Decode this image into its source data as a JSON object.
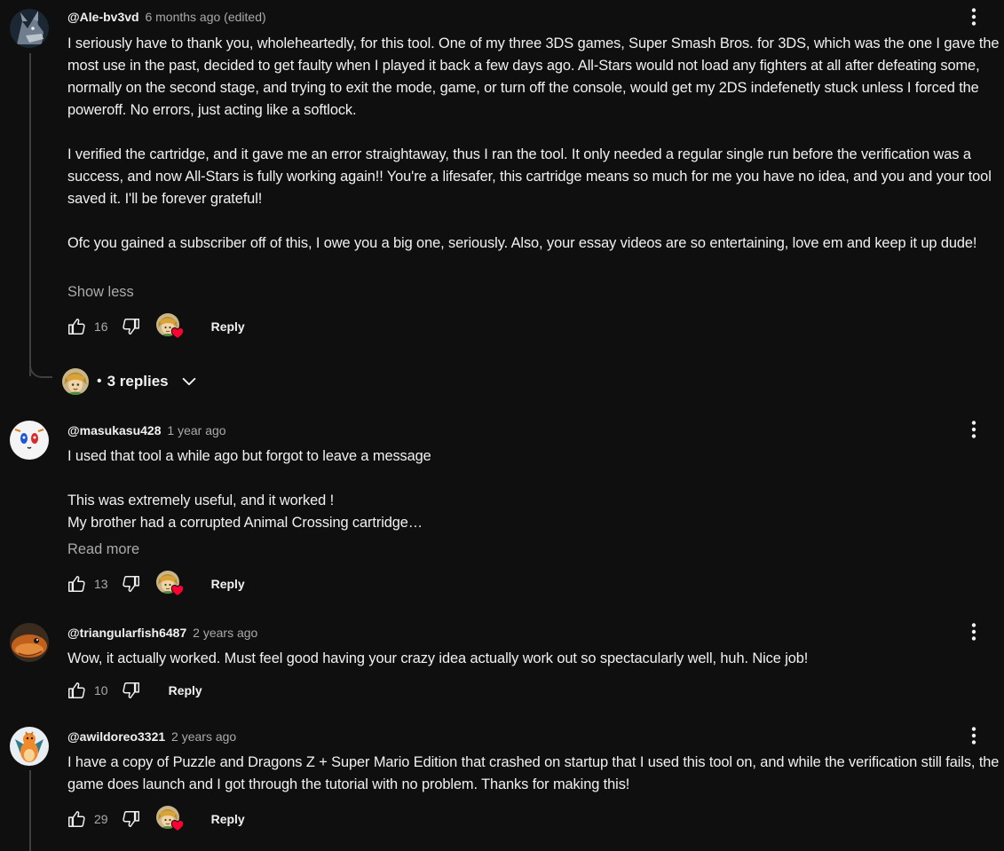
{
  "comments": [
    {
      "author": "@Ale-bv3vd",
      "time": "6 months ago (edited)",
      "text": "I seriously have to thank you, wholeheartedly, for this tool. One of my three 3DS games, Super Smash Bros. for 3DS, which was the one I gave the most use in the past, decided to get faulty when I played it back a few days ago. All-Stars would not load any fighters at all after defeating some, normally on the second stage, and trying to exit the mode, game, or turn off the console, would get my 2DS indefenetly stuck unless I forced the poweroff. No errors, just acting like a softlock.\n\nI verified the cartridge, and it gave me an error straightaway, thus I ran the tool. It only needed a regular single run before the verification was a success, and now All-Stars is fully working again!! You're a lifesafer, this cartridge means so much for me you have no idea, and you and your tool saved it. I'll be forever grateful!\n\nOfc you gained a subscriber off of this, I owe you a big one, seriously. Also, your essay videos are so entertaining, love em and keep it up dude!",
      "toggle": "Show less",
      "likes": "16",
      "reply_label": "Reply",
      "replies_label": "3 replies",
      "avatar_icon": "wolf-avatar"
    },
    {
      "author": "@masukasu428",
      "time": "1 year ago",
      "text": "I used that tool a while ago but forgot to leave a message\n\nThis was extremely useful, and it worked !\nMy brother had a corrupted Animal Crossing cartridge…",
      "toggle": "Read more",
      "likes": "13",
      "reply_label": "Reply",
      "avatar_icon": "face-avatar"
    },
    {
      "author": "@triangularfish6487",
      "time": "2 years ago",
      "text": "Wow, it actually worked. Must feel good having your crazy idea actually work out so spectacularly well, huh. Nice job!",
      "likes": "10",
      "reply_label": "Reply",
      "avatar_icon": "fish-avatar"
    },
    {
      "author": "@awildoreo3321",
      "time": "2 years ago",
      "text": "I have a copy of Puzzle and Dragons Z + Super Mario Edition that crashed on startup that I used this tool on, and while the verification still fails, the game does launch and I got through the tutorial with no problem. Thanks for making this!",
      "likes": "29",
      "reply_label": "Reply",
      "avatar_icon": "charizard-avatar"
    }
  ],
  "colors": {
    "background": "#0f0f0f",
    "text": "#f1f1f1",
    "secondary": "#aaaaaa",
    "heart": "#ff0033",
    "thread_line": "#3f3f3f"
  }
}
